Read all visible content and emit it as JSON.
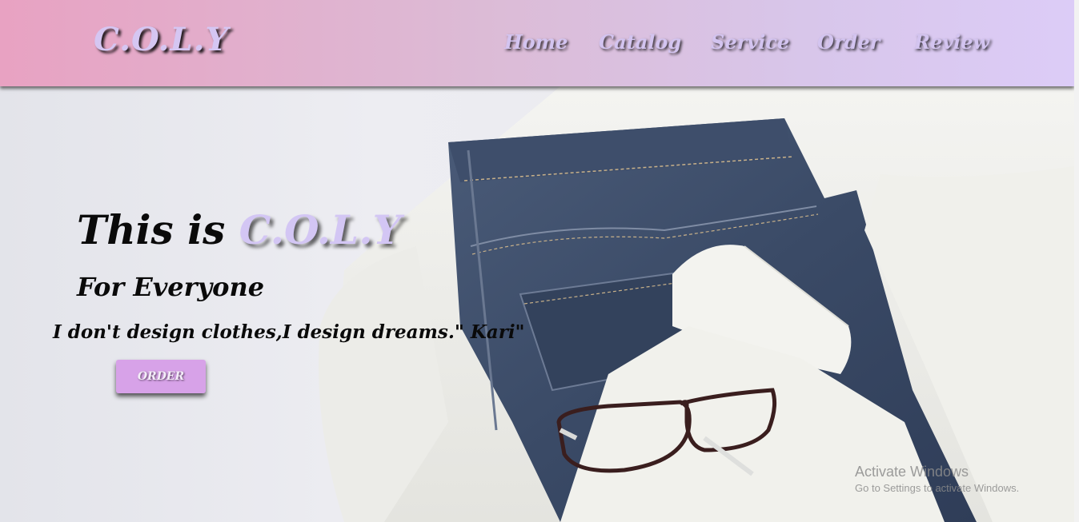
{
  "header": {
    "logo": "C.O.L.Y",
    "nav": [
      "Home",
      "Catalog",
      "Service",
      "Order",
      "Review"
    ]
  },
  "hero": {
    "headline_prefix": "This is ",
    "headline_brand": "C.O.L.Y",
    "subheading": "For Everyone",
    "quote": "I don't design clothes,I design dreams.\" Kari\"",
    "order_button": "ORDER"
  },
  "watermark": {
    "line1": "Activate Windows",
    "line2": "Go to Settings to activate Windows."
  },
  "colors": {
    "brand_lavender": "#d3c6f4",
    "button_purple": "#d7a2e8",
    "header_pink": "#e8a2c2",
    "header_lavender": "#dcccf7"
  }
}
